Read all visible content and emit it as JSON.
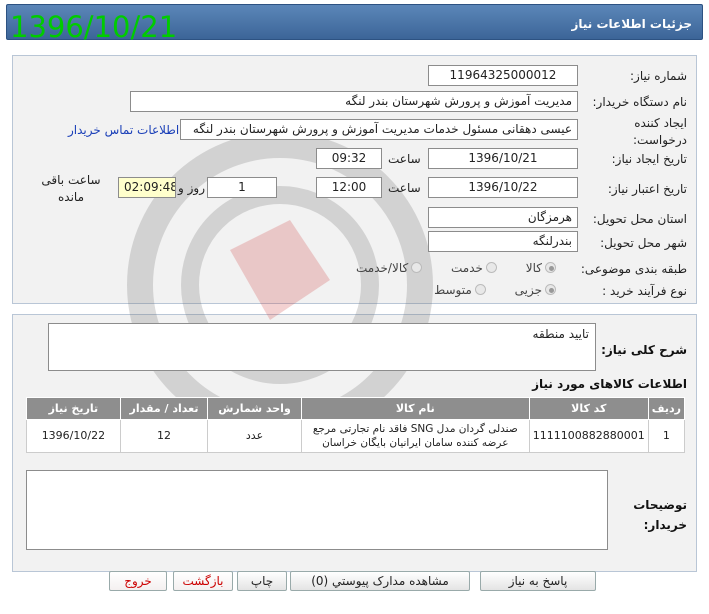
{
  "header": {
    "title": "جزئیات اطلاعات نیاز"
  },
  "big_date": "1396/10/21",
  "form": {
    "need_number": {
      "label": "شماره نیاز:",
      "value": "1196432500001​2"
    },
    "buyer_org": {
      "label": "نام دستگاه خریدار:",
      "value": "مدیریت آموزش و پرورش شهرستان بندر لنگه"
    },
    "creator": {
      "label": "ایجاد کننده درخواست:",
      "value": "عیسی دهقانی  مسئول خدمات مدیریت آموزش و پرورش شهرستان بندر لنگه",
      "contact_link": "اطلاعات تماس خریدار"
    },
    "created": {
      "label": "تاریخ ایجاد نیاز:",
      "date": "1396/10/21",
      "time_label": "ساعت",
      "time": "09:32"
    },
    "validity": {
      "label": "تاریخ اعتبار نیاز:",
      "date": "1396/10/22",
      "time_label": "ساعت",
      "time": "12:00",
      "days": "1",
      "days_label": "روز و",
      "remaining": "02:09:48",
      "remaining_label": "ساعت باقی مانده"
    },
    "province": {
      "label": "استان محل تحویل:",
      "value": "هرمزگان"
    },
    "city": {
      "label": "شهر محل تحویل:",
      "value": "بندرلنگه"
    },
    "category": {
      "label": "طبقه بندی موضوعی:",
      "options": [
        "کالا",
        "خدمت",
        "کالا/خدمت"
      ],
      "selected": "کالا"
    },
    "process": {
      "label": "نوع فرآیند خرید :",
      "options": [
        "جزیی",
        "متوسط"
      ],
      "selected": "جزیی"
    }
  },
  "description": {
    "label": "شرح کلی نیاز:",
    "value": "تایید منطقه"
  },
  "items": {
    "title": "اطلاعات کالاهای مورد نیاز",
    "columns": [
      "ردیف",
      "کد کالا",
      "نام کالا",
      "واحد شمارش",
      "تعداد / مقدار",
      "تاریخ نیاز"
    ],
    "rows": [
      [
        "1",
        "1111100882880001",
        "صندلی گردان مدل SNG فاقد نام تجارتی مرجع عرضه کننده سامان ایرانیان بایگان خراسان",
        "عدد",
        "12",
        "1396/10/22"
      ]
    ]
  },
  "buyer_notes": {
    "label": "توضیحات خریدار:",
    "value": ""
  },
  "buttons": {
    "reply": "پاسخ به نیاز",
    "attachments": "مشاهده مدارک پیوستي (0)",
    "print": "چاپ",
    "back": "بازگشت",
    "exit": "خروج"
  },
  "colors": {
    "header": "#3c6598",
    "date_green": "#00cc00",
    "table_header": "#8e8e8e",
    "link": "#1a3fb8"
  }
}
